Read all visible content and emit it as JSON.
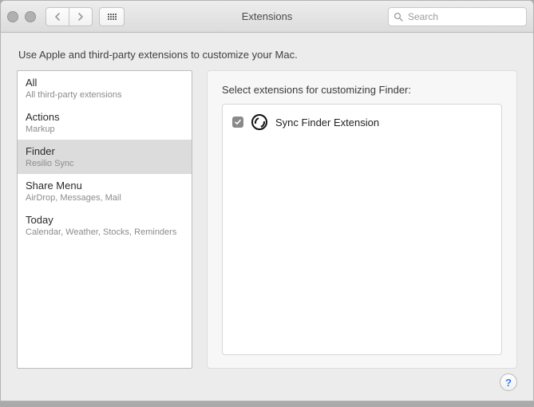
{
  "window": {
    "title": "Extensions",
    "prompt": "Use Apple and third-party extensions to customize your Mac."
  },
  "toolbar": {
    "search_placeholder": "Search"
  },
  "sidebar": {
    "selected_index": 2,
    "items": [
      {
        "title": "All",
        "subtitle": "All third-party extensions"
      },
      {
        "title": "Actions",
        "subtitle": "Markup"
      },
      {
        "title": "Finder",
        "subtitle": "Resilio Sync"
      },
      {
        "title": "Share Menu",
        "subtitle": "AirDrop, Messages, Mail"
      },
      {
        "title": "Today",
        "subtitle": "Calendar, Weather, Stocks, Reminders"
      }
    ]
  },
  "main": {
    "heading": "Select extensions for customizing Finder:",
    "extensions": [
      {
        "name": "Sync Finder Extension",
        "checked": true,
        "icon": "resilio-sync-icon"
      }
    ]
  },
  "help_label": "?"
}
